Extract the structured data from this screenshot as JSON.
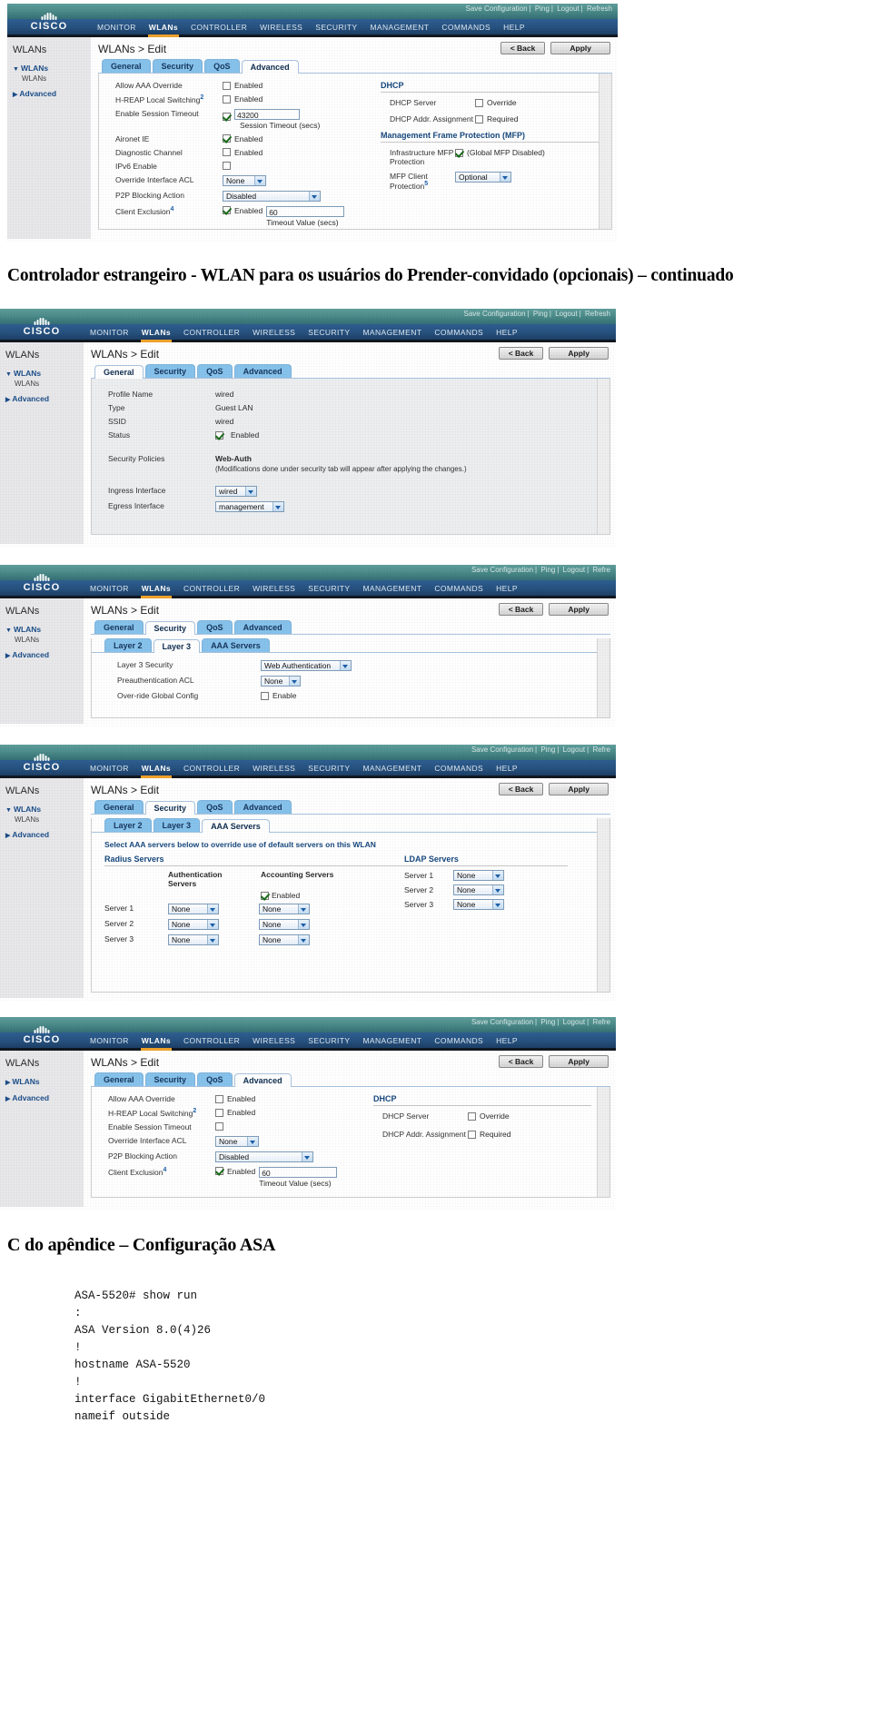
{
  "headings": {
    "h1": "Controlador estrangeiro - WLAN para os usuários do Prender-convidado (opcionais) – continuado",
    "h2": "C do apêndice – Configuração ASA"
  },
  "wlc_chrome": {
    "brand": "CISCO",
    "top_links": [
      "Save Configuration",
      "Ping",
      "Logout",
      "Refresh"
    ],
    "top_links_short": [
      "Save Configuration",
      "Ping",
      "Logout",
      "Refre"
    ],
    "nav": [
      "MONITOR",
      "WLANs",
      "CONTROLLER",
      "WIRELESS",
      "SECURITY",
      "MANAGEMENT",
      "COMMANDS",
      "HELP"
    ],
    "active_nav": "WLANs",
    "sidebar_title": "WLANs",
    "sidebar_group_1": "WLANs",
    "sidebar_sub_1": "WLANs",
    "sidebar_group_2": "Advanced",
    "breadcrumb": "WLANs > Edit",
    "back_button": "< Back",
    "apply_button": "Apply",
    "tabs": [
      "General",
      "Security",
      "QoS",
      "Advanced"
    ],
    "subtabs": [
      "Layer 2",
      "Layer 3",
      "AAA Servers"
    ]
  },
  "shot1": {
    "active_tab": "Advanced",
    "fields": [
      {
        "label": "Allow AAA Override",
        "checked": false,
        "text": "Enabled"
      },
      {
        "label": "H-REAP Local Switching",
        "sup": "2",
        "checked": false,
        "text": "Enabled"
      },
      {
        "label": "Enable Session Timeout",
        "checked": true,
        "value": "43200",
        "caption": "Session Timeout (secs)"
      },
      {
        "label": "Aironet IE",
        "checked": true,
        "text": "Enabled"
      },
      {
        "label": "Diagnostic Channel",
        "checked": false,
        "text": "Enabled"
      },
      {
        "label": "IPv6 Enable",
        "checked": false,
        "text": ""
      },
      {
        "label": "Override Interface ACL",
        "select": "None"
      },
      {
        "label": "P2P Blocking Action",
        "select": "Disabled"
      },
      {
        "label": "Client Exclusion",
        "sup": "4",
        "checked": true,
        "text": "Enabled",
        "value": "60",
        "caption": "Timeout Value (secs)"
      }
    ],
    "dhcp_header": "DHCP",
    "dhcp_rows": [
      {
        "label": "DHCP Server",
        "checked": false,
        "text": "Override"
      },
      {
        "label": "DHCP Addr. Assignment",
        "checked": false,
        "text": "Required"
      }
    ],
    "mfp_header": "Management Frame Protection (MFP)",
    "mfp_rows": [
      {
        "label": "Infrastructure MFP Protection",
        "checked": true,
        "text": "(Global MFP Disabled)"
      },
      {
        "label": "MFP Client Protection",
        "sup": "5",
        "select": "Optional"
      }
    ]
  },
  "shot2": {
    "active_tab": "General",
    "rows": [
      {
        "label": "Profile Name",
        "value": "wired"
      },
      {
        "label": "Type",
        "value": "Guest LAN"
      },
      {
        "label": "SSID",
        "value": "wired"
      },
      {
        "label": "Status",
        "checked": true,
        "value": "Enabled"
      }
    ],
    "security_policies_label": "Security Policies",
    "security_policies_value": "Web-Auth",
    "security_policies_note": "(Modifications done under security tab will appear after applying the changes.)",
    "ingress_label": "Ingress Interface",
    "ingress_value": "wired",
    "egress_label": "Egress Interface",
    "egress_value": "management"
  },
  "shot3": {
    "active_tab": "Security",
    "active_subtab": "Layer 3",
    "rows": [
      {
        "label": "Layer 3 Security",
        "select": "Web Authentication"
      },
      {
        "label": "Preauthentication ACL",
        "select": "None"
      },
      {
        "label": "Over-ride Global Config",
        "checked": false,
        "text": "Enable"
      }
    ]
  },
  "shot4": {
    "active_tab": "Security",
    "active_subtab": "AAA Servers",
    "note": "Select AAA servers below to override use of default servers on this WLAN",
    "radius_header": "Radius Servers",
    "ldap_header": "LDAP Servers",
    "col_auth": "Authentication Servers",
    "col_acct": "Accounting Servers",
    "acct_enabled_label": "Enabled",
    "acct_enabled": true,
    "rows": [
      {
        "label": "Server 1",
        "auth": "None",
        "acct": "None"
      },
      {
        "label": "Server 2",
        "auth": "None",
        "acct": "None"
      },
      {
        "label": "Server 3",
        "auth": "None",
        "acct": "None"
      }
    ],
    "ldap_rows": [
      {
        "label": "Server 1",
        "value": "None"
      },
      {
        "label": "Server 2",
        "value": "None"
      },
      {
        "label": "Server 3",
        "value": "None"
      }
    ]
  },
  "shot5": {
    "active_tab": "Advanced",
    "sidebar_group_1": "WLANs",
    "sidebar_group_2": "Advanced",
    "fields": [
      {
        "label": "Allow AAA Override",
        "checked": false,
        "text": "Enabled"
      },
      {
        "label": "H-REAP Local Switching",
        "sup": "2",
        "checked": false,
        "text": "Enabled"
      },
      {
        "label": "Enable Session Timeout",
        "checked": false,
        "text": ""
      },
      {
        "label": "Override Interface ACL",
        "select": "None"
      },
      {
        "label": "P2P Blocking Action",
        "select": "Disabled"
      },
      {
        "label": "Client Exclusion",
        "sup": "4",
        "checked": true,
        "text": "Enabled",
        "value": "60",
        "caption": "Timeout Value (secs)"
      }
    ],
    "dhcp_header": "DHCP",
    "dhcp_rows": [
      {
        "label": "DHCP Server",
        "checked": false,
        "text": "Override"
      },
      {
        "label": "DHCP Addr. Assignment",
        "checked": false,
        "text": "Required"
      }
    ]
  },
  "asa_config": "ASA-5520# show run\n:\nASA Version 8.0(4)26\n!\nhostname ASA-5520\n!\ninterface GigabitEthernet0/0\nnameif outside"
}
